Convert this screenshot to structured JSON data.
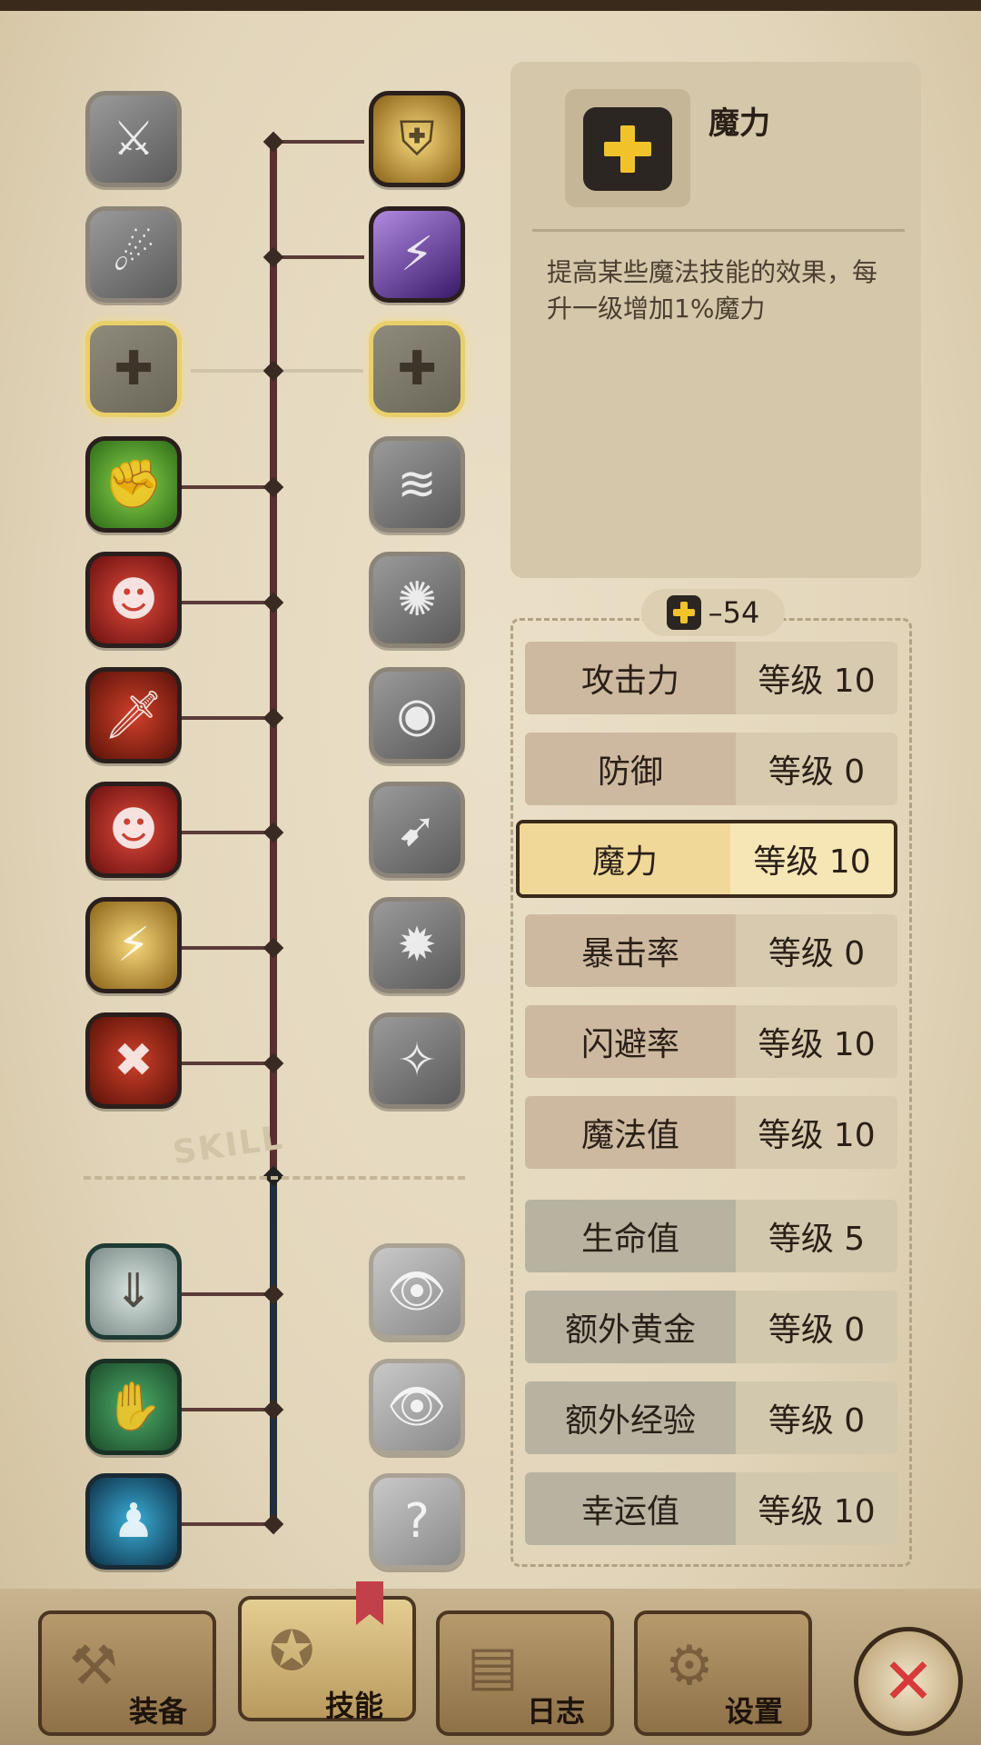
{
  "info": {
    "title": "魔力",
    "description": "提高某些魔法技能的效果，每升一级增加1%魔力"
  },
  "points": "–54",
  "watermark": "SKILL",
  "stats": [
    {
      "name": "攻击力",
      "level": "等级 10"
    },
    {
      "name": "防御",
      "level": "等级 0"
    },
    {
      "name": "魔力",
      "level": "等级 10"
    },
    {
      "name": "暴击率",
      "level": "等级 0"
    },
    {
      "name": "闪避率",
      "level": "等级 10"
    },
    {
      "name": "魔法值",
      "level": "等级 10"
    },
    {
      "name": "生命值",
      "level": "等级 5"
    },
    {
      "name": "额外黄金",
      "level": "等级 0"
    },
    {
      "name": "额外经验",
      "level": "等级 0"
    },
    {
      "name": "幸运值",
      "level": "等级 10"
    }
  ],
  "tabs": [
    {
      "label": "装备"
    },
    {
      "label": "技能"
    },
    {
      "label": "日志"
    },
    {
      "label": "设置"
    }
  ],
  "skill_icons_left": [
    "blade-slash-icon",
    "dodge-icon",
    "magic-plus-icon",
    "muscle-icon",
    "shadow-strike-icon",
    "golden-dagger-icon",
    "shadow-assassin-icon",
    "lightning-golem-icon",
    "cross-sword-icon",
    "trap-icon",
    "treasure-grab-icon",
    "blue-aura-icon"
  ],
  "skill_icons_right": [
    "holy-shield-icon",
    "purple-lightning-icon",
    "magic-plus-burst-icon",
    "dash-icon",
    "explosion-icon",
    "eye-orb-icon",
    "flying-fish-icon",
    "vortex-icon",
    "sparkle-ghost-icon",
    "watch-eye-icon",
    "eye-chest-icon",
    "mystery-figure-icon"
  ],
  "colors": {
    "accent": "#f2c22a",
    "close": "#d83a3a",
    "selected": "#f0d898"
  }
}
